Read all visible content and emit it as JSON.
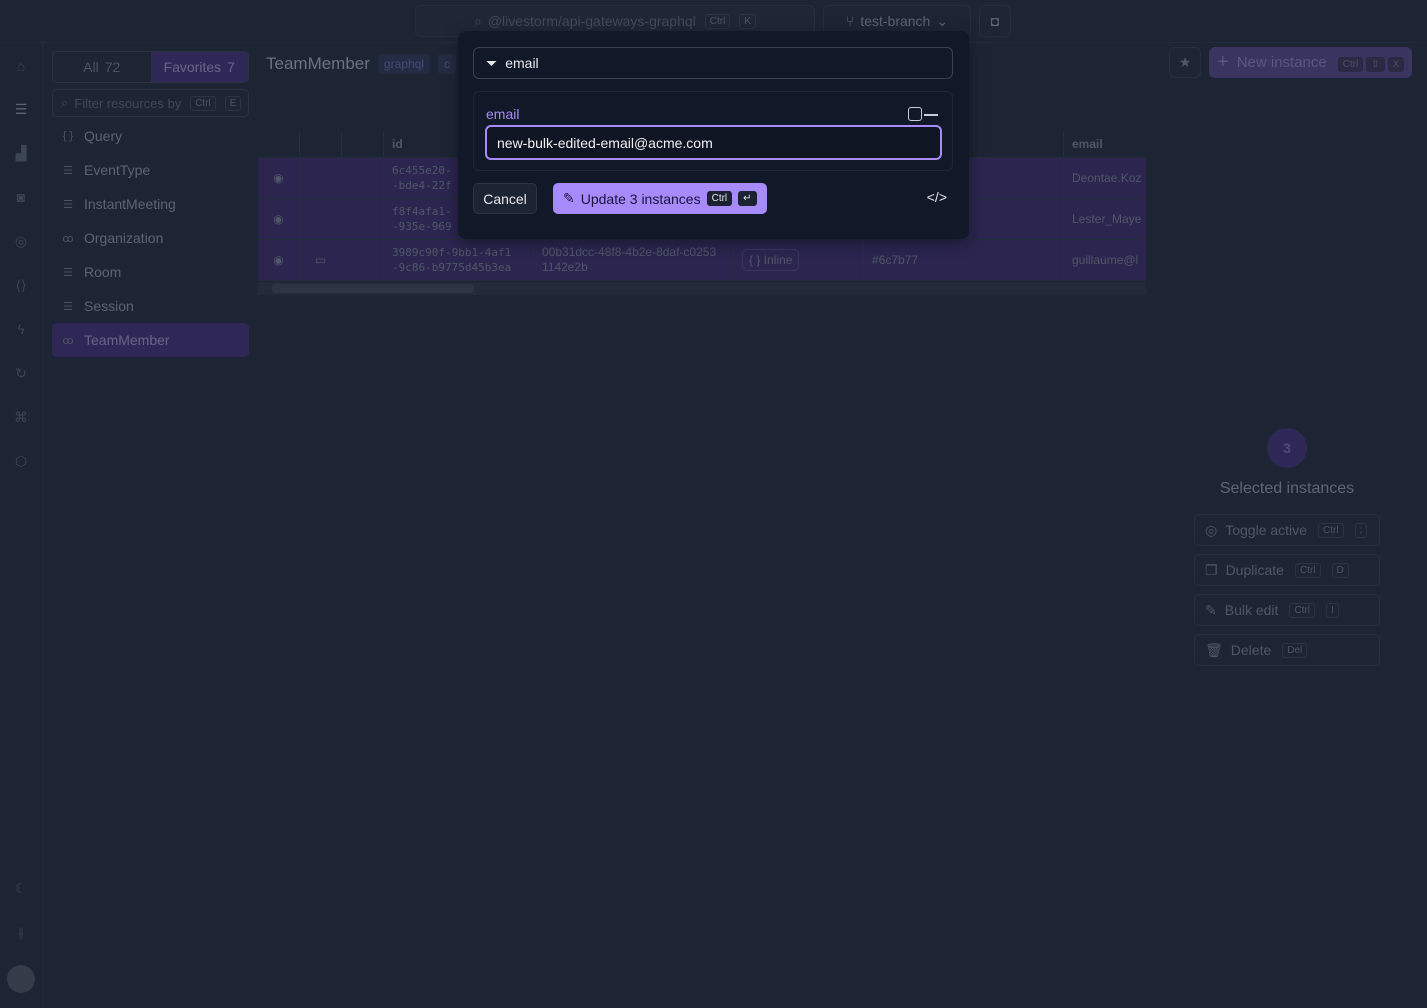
{
  "topbar": {
    "search_placeholder": "@livestorm/api-gateways-graphql",
    "search_kbd": [
      "Ctrl",
      "K"
    ],
    "branch": "test-branch"
  },
  "sidebar": {
    "tabs": [
      {
        "label": "All",
        "count": "72"
      },
      {
        "label": "Favorites",
        "count": "7"
      }
    ],
    "filter_placeholder": "Filter resources by",
    "filter_kbd": [
      "Ctrl",
      "E"
    ],
    "items": [
      {
        "label": "Query",
        "icon": "braces-icon"
      },
      {
        "label": "EventType",
        "icon": "database-icon"
      },
      {
        "label": "InstantMeeting",
        "icon": "database-icon"
      },
      {
        "label": "Organization",
        "icon": "users-icon"
      },
      {
        "label": "Room",
        "icon": "database-icon"
      },
      {
        "label": "Session",
        "icon": "database-icon"
      },
      {
        "label": "TeamMember",
        "icon": "users-icon",
        "active": true
      }
    ]
  },
  "main": {
    "title": "TeamMember",
    "tags": [
      "graphql",
      "c"
    ],
    "columns": [
      "id",
      "email"
    ],
    "rows": [
      {
        "id": "6c455e20-\n-bde4-22f",
        "email": "Deontae.Koz"
      },
      {
        "id": "f8f4afa1-\n-935e-969",
        "email": "Lester_Maye"
      },
      {
        "id": "3989c90f-9bb1-4af1\n-9c86-b9775d45b3ea",
        "ref": "00b31dcc-48f8-4b2e-8daf-c0253\n1142e2b",
        "type": "{ } Inline",
        "color": "#6c7b77",
        "email": "guillaume@l"
      }
    ]
  },
  "actions": {
    "new_instance": "New instance",
    "new_kbd": [
      "Ctrl",
      "⇧",
      "X"
    ]
  },
  "selection": {
    "count": "3",
    "label": "Selected instances",
    "buttons": [
      {
        "label": "Toggle active",
        "kbd": [
          "Ctrl",
          ";"
        ]
      },
      {
        "label": "Duplicate",
        "kbd": [
          "Ctrl",
          "D"
        ]
      },
      {
        "label": "Bulk edit",
        "kbd": [
          "Ctrl",
          "I"
        ]
      },
      {
        "label": "Delete",
        "kbd": [
          "Del"
        ]
      }
    ]
  },
  "modal": {
    "filter_value": "email",
    "field_label": "email",
    "field_value": "new-bulk-edited-email@acme.com",
    "cancel": "Cancel",
    "update": "Update 3 instances",
    "update_kbd": [
      "Ctrl",
      "↵"
    ]
  },
  "colors": {
    "accent": "#a78bfa",
    "selected_row": "#2b2550"
  }
}
